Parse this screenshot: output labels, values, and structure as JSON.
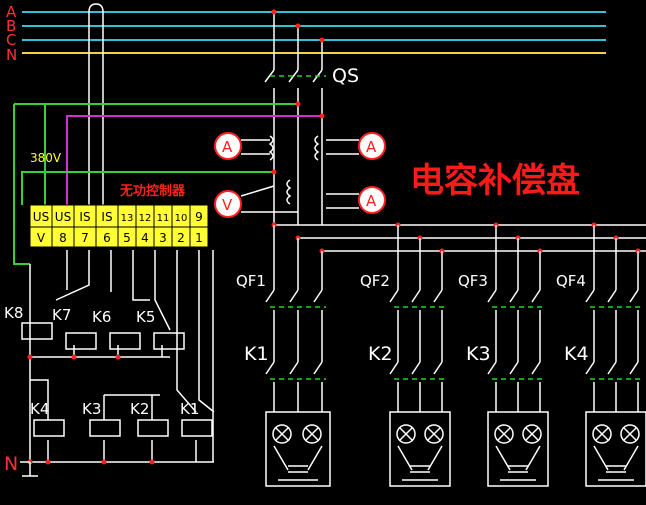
{
  "bus": {
    "phases": [
      "A",
      "B",
      "C",
      "N"
    ],
    "colors": {
      "A": "#ff3030",
      "B": "#ff3030",
      "C": "#ff3030",
      "N": "#ff3030"
    }
  },
  "labels": {
    "qs": "QS",
    "v380": "380V",
    "controller": "无功控制器",
    "title": "电容补偿盘",
    "n_bottom": "N",
    "ammeter": "A",
    "voltmeter": "V"
  },
  "terminals": {
    "top": [
      "US",
      "US",
      "IS",
      "IS",
      "13",
      "12",
      "11",
      "10",
      "9"
    ],
    "bottom": [
      "V",
      "8",
      "7",
      "6",
      "5",
      "4",
      "3",
      "2",
      "1"
    ]
  },
  "relays": [
    "K8",
    "K7",
    "K6",
    "K5",
    "K4",
    "K3",
    "K2",
    "K1"
  ],
  "groups": [
    {
      "qf": "QF1",
      "k": "K1"
    },
    {
      "qf": "QF2",
      "k": "K2"
    },
    {
      "qf": "QF3",
      "k": "K3"
    },
    {
      "qf": "QF4",
      "k": "K4"
    }
  ],
  "colors": {
    "bus_line": "#31c2d8",
    "n_line": "#f2d33a",
    "wire": "#ffffff",
    "junction": "#ff2020",
    "green": "#35d235",
    "magenta": "#d030d0",
    "dashed": "#1ed81e",
    "terminal_fill": "#ffff33",
    "title": "#ff1a1a",
    "controller_label": "#ff2020",
    "v380": "#ffff33"
  }
}
